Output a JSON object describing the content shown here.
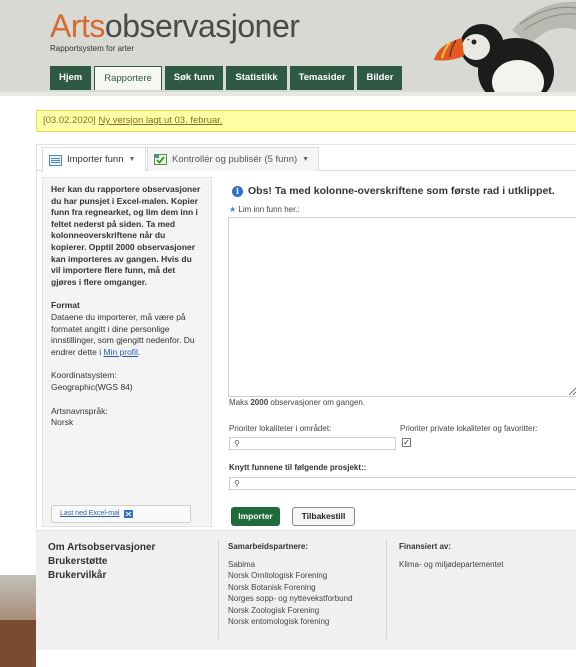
{
  "header": {
    "logo_part1": "Arts",
    "logo_part2": "observasjoner",
    "tagline": "Rapportsystem for arter",
    "nav": [
      "Hjem",
      "Rapportere",
      "Søk funn",
      "Statistikk",
      "Temasider",
      "Bilder"
    ],
    "active_nav": "Rapportere"
  },
  "announcement": {
    "date": "[03.02.2020]",
    "link": "Ny versjon lagt ut 03. februar."
  },
  "tabs": {
    "import": "Importer funn",
    "control": "Kontrollér og publisér (5 funn)"
  },
  "sidebar": {
    "intro": "Her kan du rapportere observasjoner du har punsjet i Excel-malen. Kopier funn fra regnearket, og lim dem inn i feltet nederst på siden. Ta med kolonneoverskriftene når du kopierer. Opptil 2000 observasjoner kan importeres av gangen. Hvis du vil importere flere funn, må det gjøres i flere omganger.",
    "format_title": "Format",
    "format_text": "Dataene du importerer, må være på formatet angitt i dine personlige innstillinger, som gjengitt nedenfor. Du endrer dette i",
    "format_link": "Min profil",
    "coord_label": "Koordinatsystem:",
    "coord_value": "Geographic(WGS 84)",
    "lang_label": "Artsnavnspråk:",
    "lang_value": "Norsk",
    "excel_button": "Last ned Excel-mal"
  },
  "main": {
    "notice": "Obs! Ta med kolonne-overskriftene som første rad i utklippet.",
    "paste_label": "Lim inn funn her.:",
    "maks_prefix": "Maks ",
    "maks_number": "2000",
    "maks_suffix": " observasjoner om gangen.",
    "prior_area_label": "Prioriter lokaliteter i området:",
    "prior_private_label": "Prioriter private lokaliteter og favoritter:",
    "prior_private_checked": true,
    "project_label": "Knytt funnene til følgende prosjekt::",
    "import_button": "Importer",
    "reset_button": "Tilbakestill"
  },
  "footer": {
    "links": [
      "Om Artsobservasjoner",
      "Brukerstøtte",
      "Brukervilkår"
    ],
    "partners_title": "Samarbeidspartnere:",
    "partners": [
      "Sabima",
      "Norsk Ornitologisk Forening",
      "Norsk Botanisk Forening",
      "Norges sopp- og nyttevekstforbund",
      "Norsk Zoologisk Forening",
      "Norsk entomologisk forening"
    ],
    "funded_title": "Finansiert av:",
    "funded": [
      "Klima- og miljødepartementet"
    ]
  },
  "colors": {
    "brand_orange": "#d8692f",
    "nav_green": "#2e5a43",
    "import_green": "#1f6b3a",
    "info_blue": "#2d6ec9"
  }
}
